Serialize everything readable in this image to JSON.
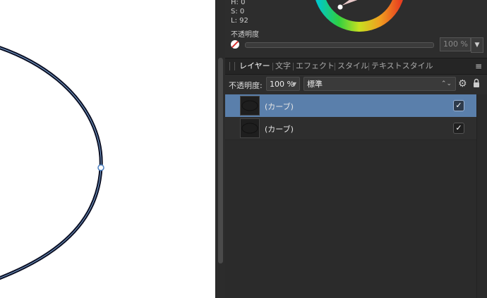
{
  "color_panel": {
    "h": "H: 0",
    "s": "S: 0",
    "l": "L: 92",
    "opacity_label": "不透明度",
    "opacity_value": "100 %",
    "dropdown_arrow": "▼"
  },
  "tabs": [
    {
      "label": "レイヤー",
      "active": true
    },
    {
      "label": "文字"
    },
    {
      "label": "エフェクト"
    },
    {
      "label": "スタイル"
    },
    {
      "label": "テキストスタイル"
    }
  ],
  "menu_icon": "≡",
  "layers_toolbar": {
    "opacity_label": "不透明度:",
    "opacity_value": "100 %",
    "opacity_caret": "▼",
    "blend_mode": "標準",
    "blend_caret": "⌃⌄",
    "settings_icon": "⚙"
  },
  "layers": [
    {
      "name": "(カーブ)",
      "selected": true,
      "visible_mark": "✓"
    },
    {
      "name": "(カーブ)",
      "selected": false,
      "visible_mark": "✓"
    }
  ]
}
